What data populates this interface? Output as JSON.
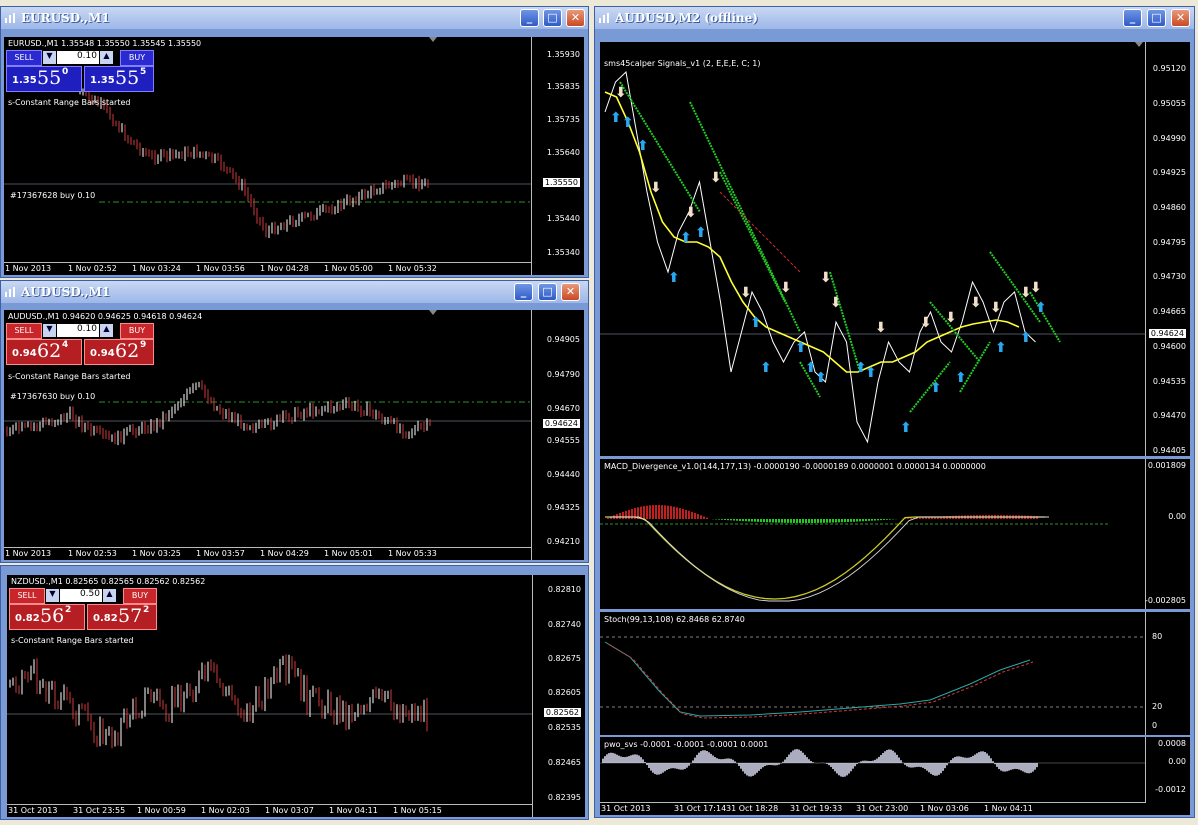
{
  "colors": {
    "bg": "#000000",
    "candle_up": "#ffffff",
    "candle_dn": "#d03a3a",
    "buy_line": "#2e8b2e",
    "macd_line": "#c9c92a",
    "ma": "#ffff33"
  },
  "eurusd": {
    "title": "EURUSD.,M1",
    "info": "EURUSD.,M1  1.35548 1.35550 1.35545 1.35550",
    "sell": "SELL",
    "buy": "BUY",
    "lot": "0.10",
    "bid": {
      "big": "1.35",
      "mid": "55",
      "sup": "0"
    },
    "ask": {
      "big": "1.35",
      "mid": "55",
      "sup": "5"
    },
    "status": "s-Constant Range Bars started",
    "order": "#17367628 buy 0.10",
    "yticks": [
      "1.35930",
      "1.35835",
      "1.35735",
      "1.35640",
      "1.35550",
      "1.35440",
      "1.35340"
    ],
    "price_tag": "1.35550",
    "xticks": [
      "1 Nov 2013",
      "1 Nov 02:52",
      "1 Nov 03:24",
      "1 Nov 03:56",
      "1 Nov 04:28",
      "1 Nov 05:00",
      "1 Nov 05:32"
    ]
  },
  "audusd1": {
    "title": "AUDUSD.,M1",
    "info": "AUDUSD.,M1  0.94620 0.94625 0.94618 0.94624",
    "sell": "SELL",
    "buy": "BUY",
    "lot": "0.10",
    "bid": {
      "big": "0.94",
      "mid": "62",
      "sup": "4"
    },
    "ask": {
      "big": "0.94",
      "mid": "62",
      "sup": "9"
    },
    "status": "s-Constant Range Bars started",
    "order": "#17367630 buy 0.10",
    "yticks": [
      "0.94905",
      "0.94790",
      "0.94670",
      "0.94624",
      "0.94555",
      "0.94440",
      "0.94325",
      "0.94210"
    ],
    "price_tag": "0.94624",
    "xticks": [
      "1 Nov 2013",
      "1 Nov 02:53",
      "1 Nov 03:25",
      "1 Nov 03:57",
      "1 Nov 04:29",
      "1 Nov 05:01",
      "1 Nov 05:33"
    ]
  },
  "nzdusd": {
    "info": "NZDUSD.,M1  0.82565 0.82565 0.82562 0.82562",
    "sell": "SELL",
    "buy": "BUY",
    "lot": "0.50",
    "bid": {
      "big": "0.82",
      "mid": "56",
      "sup": "2"
    },
    "ask": {
      "big": "0.82",
      "mid": "57",
      "sup": "2"
    },
    "status": "s-Constant Range Bars started",
    "yticks": [
      "0.82810",
      "0.82740",
      "0.82675",
      "0.82605",
      "0.82562",
      "0.82535",
      "0.82465",
      "0.82395"
    ],
    "price_tag": "0.82562",
    "xticks": [
      "31 Oct 2013",
      "31 Oct 23:55",
      "1 Nov 00:59",
      "1 Nov 02:03",
      "1 Nov 03:07",
      "1 Nov 04:11",
      "1 Nov 05:15"
    ]
  },
  "audusd2": {
    "title": "AUDUSD,M2 (offline)",
    "indicator": "sms45calper Signals_v1 (2, E,E,E, C; 1)",
    "yticks": [
      "0.95120",
      "0.95055",
      "0.94990",
      "0.94925",
      "0.94860",
      "0.94795",
      "0.94730",
      "0.94665",
      "0.94624",
      "0.94600",
      "0.94535",
      "0.94470",
      "0.94405"
    ],
    "price_tag": "0.94624",
    "macd": {
      "label": "MACD_Divergence_v1.0(144,177,13) -0.0000190 -0.0000189 0.0000001 0.0000134 0.0000000",
      "yticks": [
        "0.001809",
        "0.00",
        "-0.002805"
      ]
    },
    "stoch": {
      "label": "Stoch(99,13,108) 62.8468 62.8740",
      "yticks": [
        "80",
        "20",
        "0"
      ]
    },
    "pwo": {
      "label": "pwo_svs -0.0001 -0.0001 -0.0001 0.0001",
      "yticks": [
        "0.0008",
        "0.00",
        "-0.0012"
      ]
    },
    "xticks": [
      "31 Oct 2013",
      "31 Oct 17:14",
      "31 Oct 18:28",
      "31 Oct 19:33",
      "31 Oct 23:00",
      "1 Nov 03:06",
      "1 Nov 04:11"
    ]
  }
}
